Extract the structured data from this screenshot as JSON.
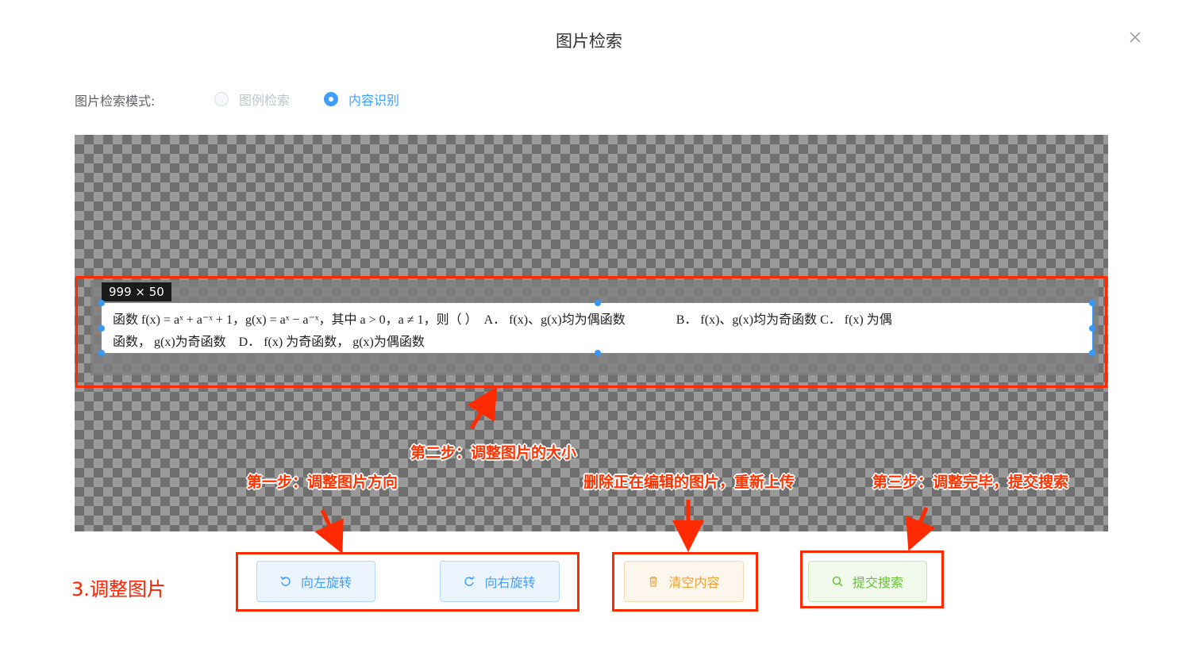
{
  "dialog": {
    "title": "图片检索"
  },
  "mode": {
    "label": "图片检索模式:",
    "options": [
      {
        "label": "图例检索",
        "state": "disabled"
      },
      {
        "label": "内容识别",
        "state": "checked"
      }
    ]
  },
  "crop": {
    "size_label": "999 × 50",
    "line1": "函数 f(x) = aˣ + a⁻ˣ + 1，g(x) = aˣ − a⁻ˣ，其中 a > 0，a ≠ 1，则（ ）  A． f(x)、g(x)均为偶函数                B． f(x)、g(x)均为奇函数 C． f(x) 为偶",
    "line2": "函数， g(x)为奇函数    D． f(x) 为奇函数， g(x)为偶函数"
  },
  "annotations": {
    "step2": "第二步：调整图片的大小",
    "step1": "第一步：调整图片方向",
    "delete": "删除正在编辑的图片，重新上传",
    "step3": "第三步：调整完毕，提交搜索"
  },
  "side_label": "3.调整图片",
  "buttons": {
    "rotate_left": "向左旋转",
    "rotate_right": "向右旋转",
    "clear": "清空内容",
    "submit": "提交搜索"
  },
  "colors": {
    "primary": "#409eff",
    "warning": "#e6a23c",
    "success": "#67c23a",
    "annotation": "#ff2a00"
  }
}
